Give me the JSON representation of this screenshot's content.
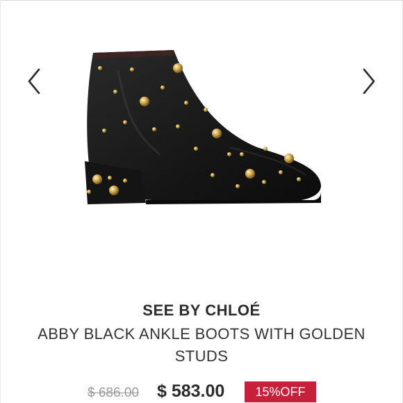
{
  "carousel": {
    "prev_icon": "chevron-left-icon",
    "next_icon": "chevron-right-icon",
    "image_subject": "black leather ankle boot with gold studs"
  },
  "product": {
    "brand": "SEE BY CHLOÉ",
    "title": "ABBY BLACK ANKLE BOOTS WITH GOLDEN STUDS",
    "original_price": "$ 686.00",
    "sale_price": "$ 583.00",
    "discount": "15%OFF"
  },
  "colors": {
    "badge": "#c6203b",
    "boot": "#1b1b1b",
    "stud": "#c9a24a"
  }
}
